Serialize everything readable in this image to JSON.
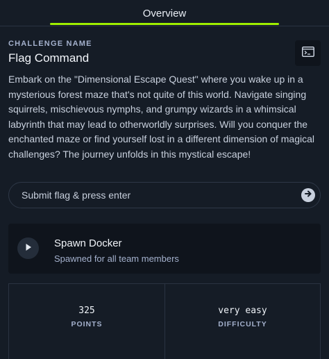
{
  "tabs": [
    {
      "label": "Overview",
      "active": true
    }
  ],
  "accent_color": "#9fef00",
  "challenge": {
    "name_label": "CHALLENGE NAME",
    "name": "Flag Command",
    "terminal_icon": "terminal-icon",
    "description": "Embark on the \"Dimensional Escape Quest\" where you wake up in a mysterious forest maze that's not quite of this world. Navigate singing squirrels, mischievous nymphs, and grumpy wizards in a whimsical labyrinth that may lead to otherworldly surprises. Will you conquer the enchanted maze or find yourself lost in a different dimension of magical challenges? The journey unfolds in this mystical escape!"
  },
  "flag": {
    "placeholder": "Submit flag & press enter",
    "value": "",
    "submit_icon": "arrow-right-circle-icon"
  },
  "spawn": {
    "title": "Spawn Docker",
    "subtitle": "Spawned for all team members",
    "icon": "play-icon"
  },
  "stats": [
    {
      "value": "325",
      "label": "POINTS"
    },
    {
      "value": "very easy",
      "label": "DIFFICULTY"
    }
  ]
}
